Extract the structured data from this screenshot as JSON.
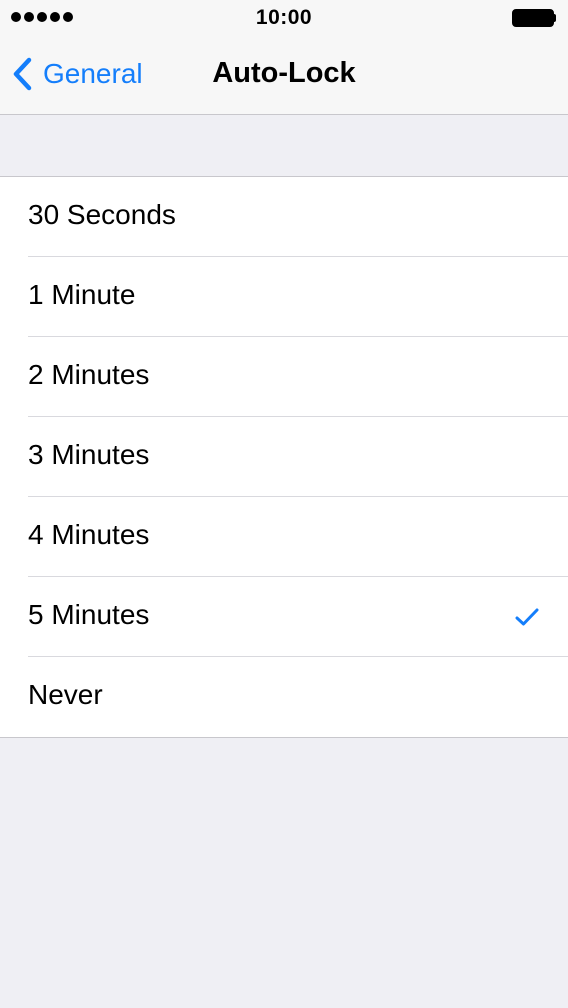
{
  "status_bar": {
    "time": "10:00",
    "signal_icon": "signal-dots-icon",
    "battery_icon": "battery-full-icon"
  },
  "nav_bar": {
    "back_label": "General",
    "back_icon": "chevron-left-icon",
    "title": "Auto-Lock"
  },
  "options": [
    {
      "label": "30 Seconds",
      "selected": false
    },
    {
      "label": "1 Minute",
      "selected": false
    },
    {
      "label": "2 Minutes",
      "selected": false
    },
    {
      "label": "3 Minutes",
      "selected": false
    },
    {
      "label": "4 Minutes",
      "selected": false
    },
    {
      "label": "5 Minutes",
      "selected": true
    },
    {
      "label": "Never",
      "selected": false
    }
  ],
  "colors": {
    "accent": "#147efb",
    "background": "#efeff4",
    "separator": "#c8c7cc"
  }
}
